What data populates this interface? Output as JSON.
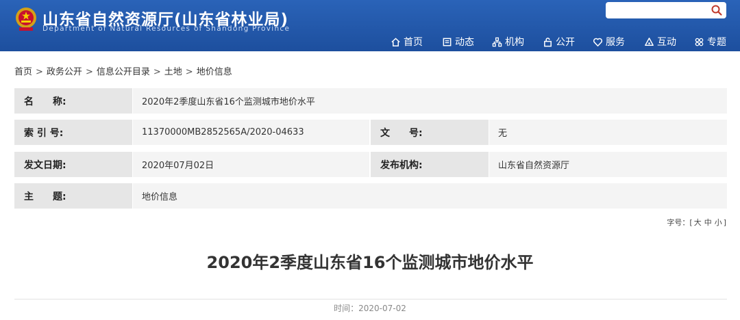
{
  "header": {
    "title": "山东省自然资源厅(山东省林业局)",
    "subtitle": "Department of Natural Resources of Shandong Province",
    "search_placeholder": ""
  },
  "nav": [
    {
      "label": "首页",
      "icon": "home-icon"
    },
    {
      "label": "动态",
      "icon": "news-icon"
    },
    {
      "label": "机构",
      "icon": "organization-icon"
    },
    {
      "label": "公开",
      "icon": "lock-icon"
    },
    {
      "label": "服务",
      "icon": "heart-icon"
    },
    {
      "label": "互动",
      "icon": "interaction-icon"
    },
    {
      "label": "专题",
      "icon": "topics-icon"
    }
  ],
  "breadcrumb": {
    "items": [
      "首页",
      "政务公开",
      "信息公开目录",
      "土地",
      "地价信息"
    ],
    "separator": ">"
  },
  "info": {
    "name_label": "名　　称:",
    "name_value": "2020年2季度山东省16个监测城市地价水平",
    "index_label": "索 引 号:",
    "index_value": "11370000MB2852565A/2020-04633",
    "docno_label": "文　　号:",
    "docno_value": "无",
    "date_label": "发文日期:",
    "date_value": "2020年07月02日",
    "org_label": "发布机构:",
    "org_value": "山东省自然资源厅",
    "topic_label": "主　　题:",
    "topic_value": "地价信息"
  },
  "font_size": {
    "label": "字号：[",
    "large": "大",
    "medium": "中",
    "small": "小",
    "close": "]"
  },
  "article": {
    "title": "2020年2季度山东省16个监测城市地价水平",
    "time_label": "时间：",
    "time_value": "2020-07-02"
  },
  "colors": {
    "header_blue": "#1d4f9e",
    "label_bg": "#e6e6e6",
    "value_bg": "#f4f4f4"
  }
}
